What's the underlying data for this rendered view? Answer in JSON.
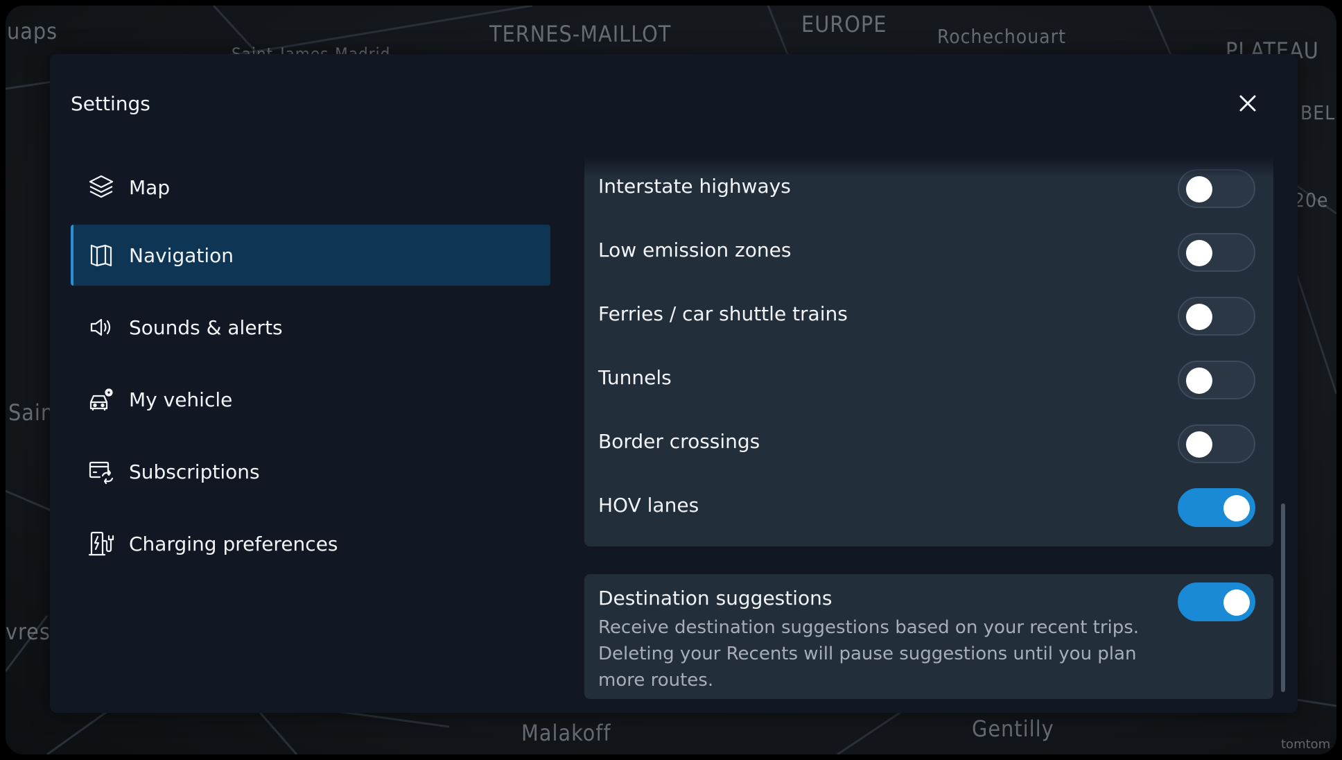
{
  "background_map": {
    "labels": [
      "uaps",
      "TERNES-MAILLOT",
      "Saint-James-Madrid",
      "EUROPE",
      "Rochechouart",
      "PLATEAU",
      "BEL",
      "20e",
      "Sain",
      "vres",
      "Malakoff",
      "Gentilly"
    ],
    "watermark": "tomtom"
  },
  "dialog": {
    "title": "Settings",
    "close_icon": "close-icon"
  },
  "sidebar": {
    "items": [
      {
        "label": "Map",
        "icon": "layers-icon",
        "active": false
      },
      {
        "label": "Navigation",
        "icon": "map-book-icon",
        "active": true
      },
      {
        "label": "Sounds & alerts",
        "icon": "speaker-icon",
        "active": false
      },
      {
        "label": "My vehicle",
        "icon": "car-settings-icon",
        "active": false
      },
      {
        "label": "Subscriptions",
        "icon": "card-sync-icon",
        "active": false
      },
      {
        "label": "Charging preferences",
        "icon": "ev-charger-icon",
        "active": false
      }
    ]
  },
  "avoid_options": [
    {
      "label": "Interstate highways",
      "enabled": false
    },
    {
      "label": "Low emission zones",
      "enabled": false
    },
    {
      "label": "Ferries / car shuttle trains",
      "enabled": false
    },
    {
      "label": "Tunnels",
      "enabled": false
    },
    {
      "label": "Border crossings",
      "enabled": false
    },
    {
      "label": "HOV lanes",
      "enabled": true
    }
  ],
  "destination_suggestions": {
    "title": "Destination suggestions",
    "description": "Receive destination suggestions based on your recent trips. Deleting your Recents will pause suggestions until you plan more routes.",
    "enabled": true
  },
  "colors": {
    "accent": "#1a8ad6",
    "active_nav_bg": "#0e3554",
    "panel_bg": "#232e3b",
    "dialog_bg": "#111823"
  }
}
